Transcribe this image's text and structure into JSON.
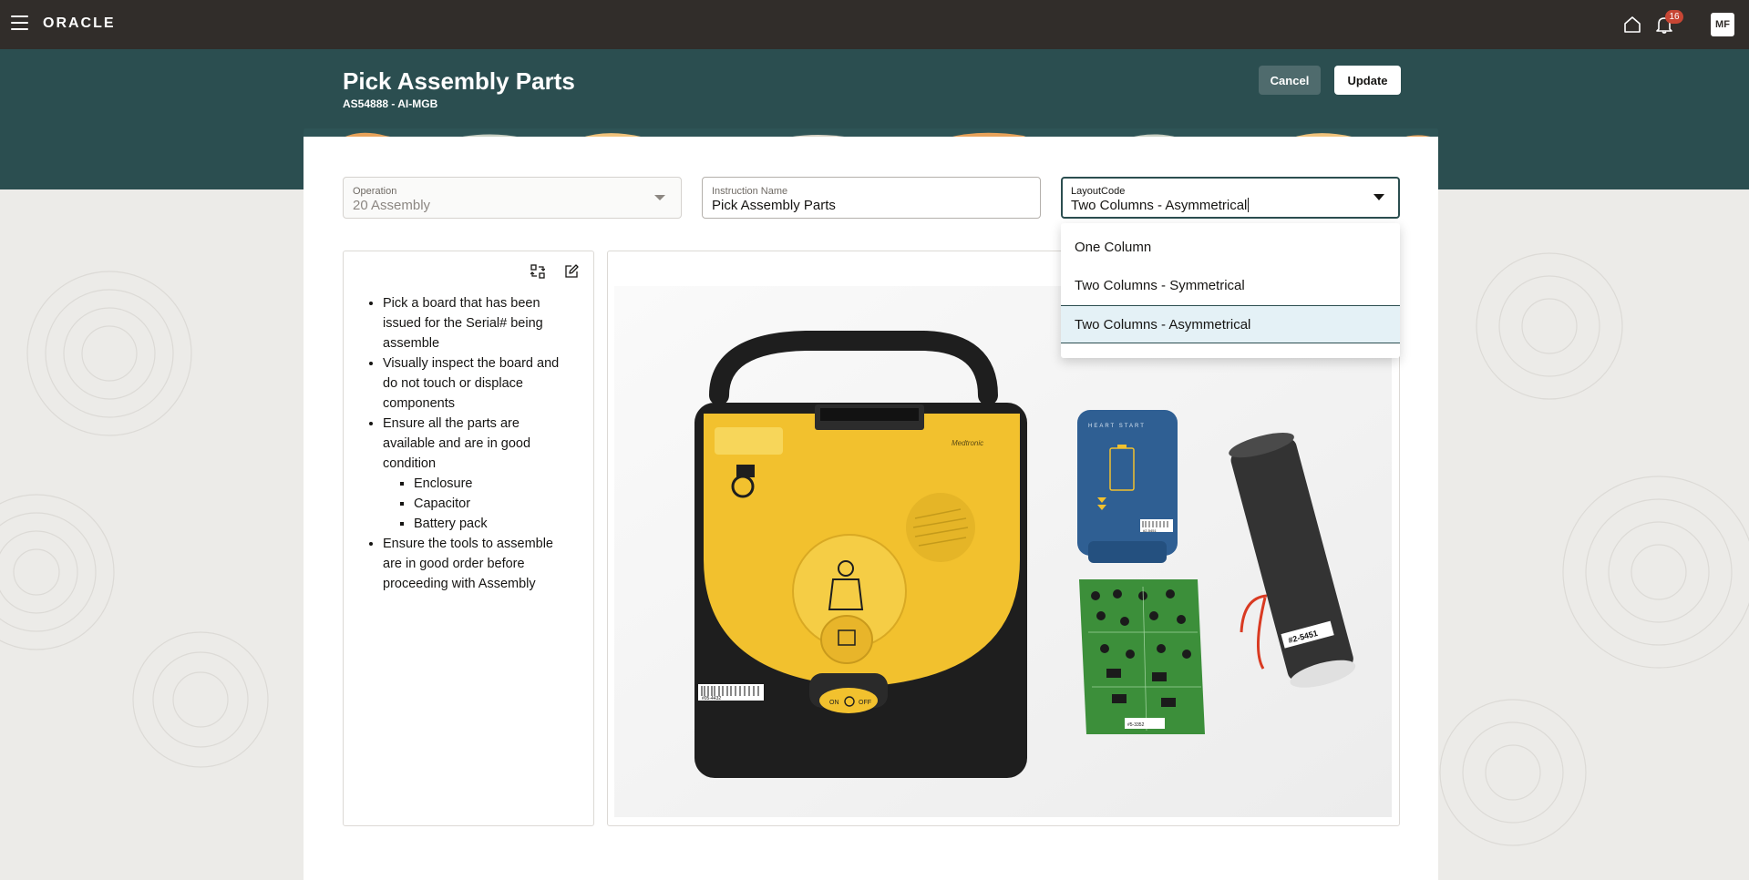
{
  "topbar": {
    "logo": "ORACLE",
    "notification_count": "16",
    "user_initials": "MF"
  },
  "header": {
    "title": "Pick Assembly Parts",
    "subtitle": "AS54888 - AI-MGB",
    "cancel_label": "Cancel",
    "update_label": "Update"
  },
  "form": {
    "operation": {
      "label": "Operation",
      "value": "20 Assembly"
    },
    "instruction_name": {
      "label": "Instruction Name",
      "value": "Pick Assembly Parts"
    },
    "layout_code": {
      "label": "LayoutCode",
      "value": "Two Columns - Asymmetrical"
    }
  },
  "dropdown": {
    "options": [
      "One Column",
      "Two Columns - Symmetrical",
      "Two Columns - Asymmetrical"
    ],
    "selected": "Two Columns - Asymmetrical"
  },
  "instructions": {
    "items": [
      "Pick a board that has been issued for the Serial# being assemble",
      "Visually inspect the board and do not touch or displace components",
      "Ensure all the parts are available and are in good condition",
      "Ensure the tools to assemble are in good order before proceeding with Assembly"
    ],
    "subitems": [
      "Enclosure",
      "Capacitor",
      "Battery pack"
    ]
  },
  "product_labels": {
    "brand": "Medtronic",
    "battery_brand": "HEART START",
    "device_on": "ON",
    "device_off": "OFF",
    "device_barcode": "#05-4432",
    "battery_barcode": "#2-5451",
    "board_barcode": "#5-3352",
    "capacitor_barcode": "#2-5451"
  },
  "colors": {
    "topbar": "#312d2a",
    "header_band": "#2b4e50",
    "badge": "#c74634",
    "device_yellow": "#f2c12e",
    "device_black": "#1e1e1e",
    "battery_blue": "#2f5f93",
    "board_green": "#3c8f3a"
  },
  "icons": {
    "menu": "hamburger-icon",
    "home": "home-icon",
    "bell": "bell-icon",
    "swap": "swap-layout-icon",
    "edit": "edit-icon"
  }
}
